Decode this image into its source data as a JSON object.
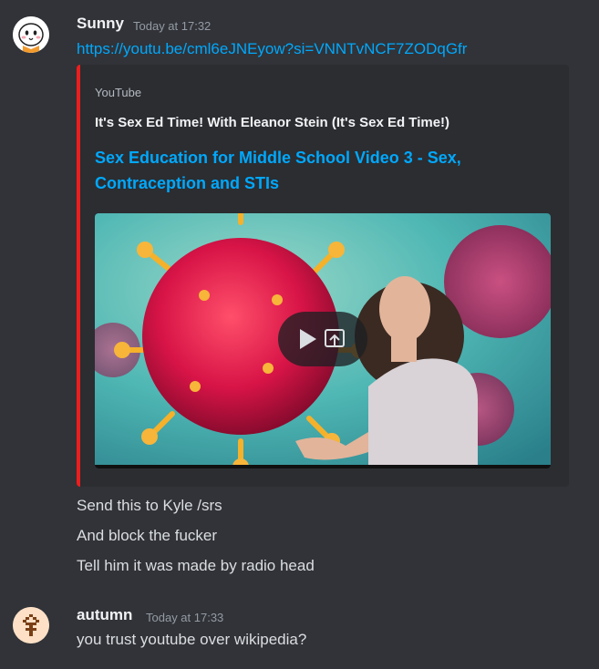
{
  "messages": [
    {
      "author": "Sunny",
      "timestamp": "Today at 17:32",
      "link": "https://youtu.be/cml6eJNEyow?si=VNNTvNCF7ZODqGfr",
      "embed": {
        "provider": "YouTube",
        "author": "It's Sex Ed Time! With Eleanor Stein (It's Sex Ed Time!)",
        "title": "Sex Education for Middle School Video 3 - Sex, Contraception and STIs",
        "accent_color": "#ee1d1d"
      },
      "lines": [
        "Send this to Kyle /srs",
        "And block the fucker",
        "Tell him it was made by radio head"
      ]
    },
    {
      "author": "autumn",
      "timestamp": "Today at 17:33",
      "lines": [
        "you trust youtube over wikipedia?"
      ]
    }
  ],
  "colors": {
    "background": "#313338",
    "embed_bg": "#2b2d31",
    "link": "#00a8fc",
    "text": "#dbdee1",
    "timestamp": "#949ba4"
  },
  "icons": [
    "sunny-avatar",
    "autumn-avatar",
    "play-icon",
    "open-external-icon"
  ]
}
